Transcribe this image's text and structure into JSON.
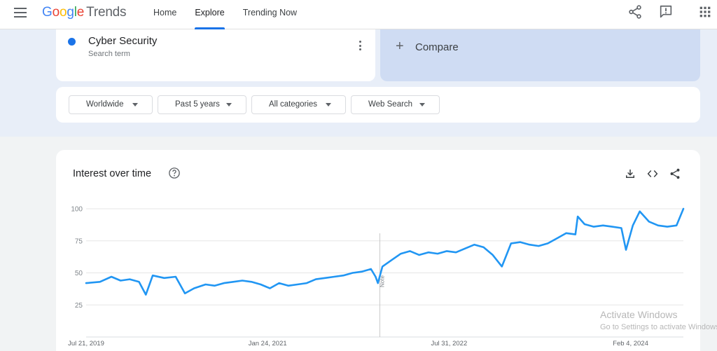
{
  "app": {
    "logo_google": [
      "G",
      "o",
      "o",
      "g",
      "l",
      "e"
    ],
    "logo_trends": "Trends"
  },
  "nav": {
    "items": [
      {
        "label": "Home"
      },
      {
        "label": "Explore"
      },
      {
        "label": "Trending Now"
      }
    ],
    "active": "Explore"
  },
  "header_icons": [
    "share-icon",
    "feedback-icon",
    "apps-grid-icon"
  ],
  "search_term": {
    "name": "Cyber Security",
    "subtitle": "Search term",
    "color": "#1a73e8"
  },
  "compare": {
    "label": "Compare"
  },
  "filters": {
    "region": "Worldwide",
    "time": "Past 5 years",
    "category": "All categories",
    "property": "Web Search"
  },
  "chart_card": {
    "title": "Interest over time",
    "icons": [
      "help-icon",
      "download-icon",
      "embed-icon",
      "share-icon"
    ]
  },
  "chart_data": {
    "type": "line",
    "title": "",
    "xlabel": "",
    "ylabel": "",
    "ylim": [
      0,
      100
    ],
    "y_ticks": [
      25,
      50,
      75,
      100
    ],
    "x_tick_labels": [
      "Jul 21, 2019",
      "Jan 24, 2021",
      "Jul 31, 2022",
      "Feb 4, 2024"
    ],
    "x_ticks": [
      "2019-07-21",
      "2021-01-24",
      "2022-07-31",
      "2024-02-04"
    ],
    "x_start": "2019-07-21",
    "x_end": "2024-07-14",
    "grid": true,
    "legend": "none",
    "annotation": {
      "date": "2022-01-01",
      "label": "Note"
    },
    "series": [
      {
        "color": "#2196f3",
        "points": [
          [
            "2019-07-21",
            42
          ],
          [
            "2019-09-01",
            43
          ],
          [
            "2019-10-06",
            47
          ],
          [
            "2019-11-03",
            44
          ],
          [
            "2019-12-01",
            45
          ],
          [
            "2019-12-29",
            43
          ],
          [
            "2020-01-19",
            33
          ],
          [
            "2020-02-09",
            48
          ],
          [
            "2020-03-15",
            46
          ],
          [
            "2020-04-19",
            47
          ],
          [
            "2020-05-17",
            34
          ],
          [
            "2020-06-14",
            38
          ],
          [
            "2020-07-19",
            41
          ],
          [
            "2020-08-16",
            40
          ],
          [
            "2020-09-13",
            42
          ],
          [
            "2020-10-11",
            43
          ],
          [
            "2020-11-08",
            44
          ],
          [
            "2020-12-06",
            43
          ],
          [
            "2021-01-03",
            41
          ],
          [
            "2021-01-31",
            38
          ],
          [
            "2021-02-28",
            42
          ],
          [
            "2021-03-28",
            40
          ],
          [
            "2021-04-25",
            41
          ],
          [
            "2021-05-23",
            42
          ],
          [
            "2021-06-20",
            45
          ],
          [
            "2021-07-18",
            46
          ],
          [
            "2021-08-15",
            47
          ],
          [
            "2021-09-12",
            48
          ],
          [
            "2021-10-10",
            50
          ],
          [
            "2021-11-07",
            51
          ],
          [
            "2021-12-05",
            53
          ],
          [
            "2021-12-19",
            47
          ],
          [
            "2021-12-26",
            42
          ],
          [
            "2022-01-09",
            55
          ],
          [
            "2022-02-06",
            60
          ],
          [
            "2022-03-06",
            65
          ],
          [
            "2022-04-03",
            67
          ],
          [
            "2022-05-01",
            64
          ],
          [
            "2022-05-29",
            66
          ],
          [
            "2022-06-26",
            65
          ],
          [
            "2022-07-24",
            67
          ],
          [
            "2022-08-21",
            66
          ],
          [
            "2022-09-18",
            69
          ],
          [
            "2022-10-16",
            72
          ],
          [
            "2022-11-13",
            70
          ],
          [
            "2022-12-11",
            64
          ],
          [
            "2023-01-08",
            55
          ],
          [
            "2023-02-05",
            73
          ],
          [
            "2023-03-05",
            74
          ],
          [
            "2023-04-02",
            72
          ],
          [
            "2023-04-30",
            71
          ],
          [
            "2023-05-28",
            73
          ],
          [
            "2023-06-25",
            77
          ],
          [
            "2023-07-23",
            81
          ],
          [
            "2023-08-20",
            80
          ],
          [
            "2023-08-27",
            94
          ],
          [
            "2023-09-17",
            88
          ],
          [
            "2023-10-15",
            86
          ],
          [
            "2023-11-12",
            87
          ],
          [
            "2023-12-10",
            86
          ],
          [
            "2024-01-07",
            85
          ],
          [
            "2024-01-21",
            68
          ],
          [
            "2024-02-11",
            87
          ],
          [
            "2024-03-03",
            98
          ],
          [
            "2024-03-31",
            90
          ],
          [
            "2024-04-28",
            87
          ],
          [
            "2024-05-26",
            86
          ],
          [
            "2024-06-23",
            87
          ],
          [
            "2024-07-14",
            100
          ]
        ]
      }
    ]
  },
  "watermark": {
    "line1": "Activate Windows",
    "line2": "Go to Settings to activate Windows."
  }
}
